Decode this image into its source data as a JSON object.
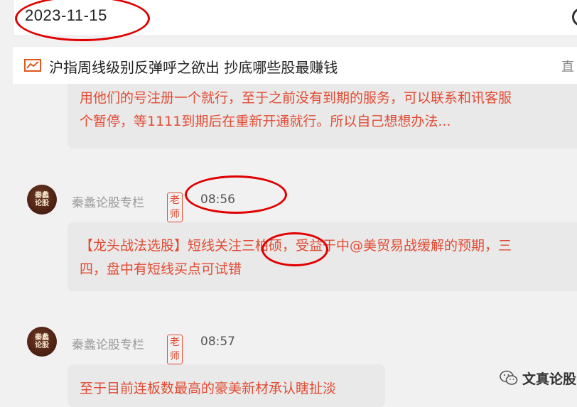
{
  "date_bar": {
    "date": "2023-11-15"
  },
  "headline": {
    "title": "沪指周线级别反弹呼之欲出 抄底哪些股最赚钱",
    "tail": "直"
  },
  "messages": [
    {
      "lines": [
        "用他们的号注册一个就行，至于之前没有到期的服务，可以联系和讯客服",
        "个暂停，等1111到期后在重新开通就行。所以自己想想办法..."
      ]
    },
    {
      "author": "秦蠡论股专栏",
      "badge": "老师",
      "time": "08:56",
      "lines": [
        "【龙头战法选股】短线关注三柏硕，受益于中@美贸易战缓解的预期，三",
        "四，盘中有短线买点可试错"
      ]
    },
    {
      "author": "秦蠡论股专栏",
      "badge": "老师",
      "time": "08:57",
      "lines": [
        "至于目前连板数最高的豪美新材承认瞎扯淡"
      ]
    }
  ],
  "avatar": {
    "line1": "秦蠡",
    "line2": "论股"
  },
  "watermark": {
    "text": "文真论股"
  },
  "colors": {
    "accent": "#e24b33",
    "annotation": "#e00000"
  }
}
